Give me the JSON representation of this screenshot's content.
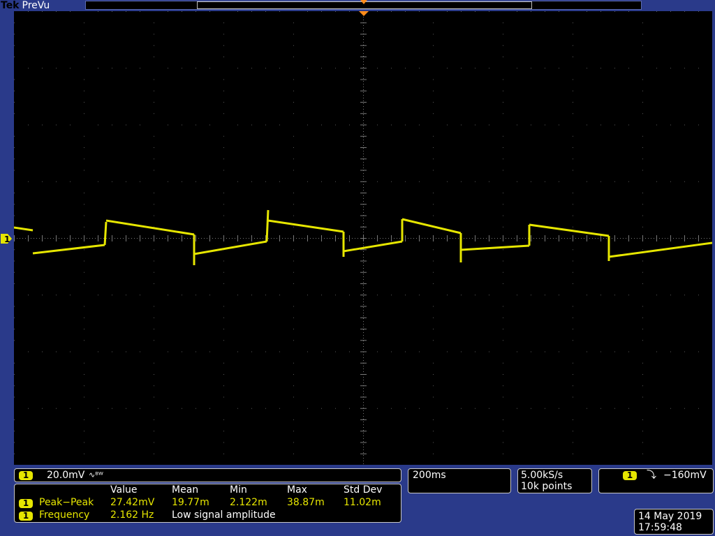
{
  "brand": {
    "maker": "Tek",
    "mode": "PreVu"
  },
  "channel": {
    "label": "1",
    "scale": "20.0mV",
    "coupling_symbol": "∿ᴮᵂ",
    "color": "#e6e600"
  },
  "measurements": {
    "headers": [
      "Value",
      "Mean",
      "Min",
      "Max",
      "Std Dev"
    ],
    "rows": [
      {
        "ch": "1",
        "name": "Peak−Peak",
        "value": "27.42mV",
        "mean": "19.77m",
        "min": "2.122m",
        "max": "38.87m",
        "std": "11.02m"
      },
      {
        "ch": "1",
        "name": "Frequency",
        "value": "2.162 Hz",
        "note": "Low signal amplitude"
      }
    ]
  },
  "timebase": {
    "scale": "200ms"
  },
  "acquisition": {
    "rate": "5.00kS/s",
    "points": "10k points"
  },
  "trigger": {
    "ch": "1",
    "slope_symbol": "⤵",
    "level": "−160mV"
  },
  "datetime": {
    "date": "14 May 2019",
    "time": "17:59:48"
  },
  "colors": {
    "background": "#2a3a8a",
    "screen": "#000000",
    "trace": "#e6e600",
    "marker": "#ff8c1a"
  }
}
